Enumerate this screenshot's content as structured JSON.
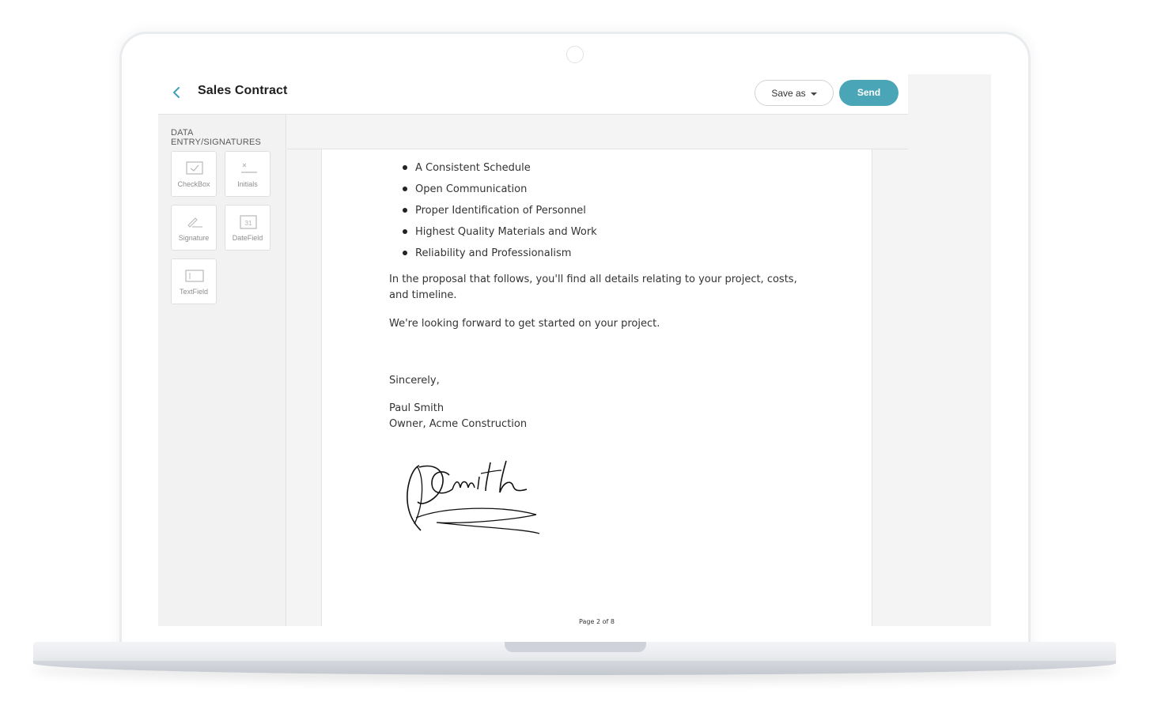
{
  "header": {
    "title": "Sales Contract",
    "save_as_label": "Save as",
    "send_label": "Send"
  },
  "sidebar": {
    "title": "DATA ENTRY/SIGNATURES",
    "tools": [
      {
        "label": "CheckBox",
        "icon": "checkbox-icon"
      },
      {
        "label": "Initials",
        "icon": "initials-icon"
      },
      {
        "label": "Signature",
        "icon": "pen-icon"
      },
      {
        "label": "DateField",
        "icon": "calendar-icon"
      },
      {
        "label": "TextField",
        "icon": "textfield-icon"
      }
    ],
    "date_icon_text": "31"
  },
  "document": {
    "bullets": [
      "A Consistent Schedule",
      "Open Communication",
      "Proper Identification of Personnel",
      "Highest Quality Materials and Work",
      "Reliability and Professionalism"
    ],
    "paragraph_1": "In the proposal that follows, you'll find all details relating to your project, costs, and timeline.",
    "paragraph_2": "We're looking forward to get started on your project.",
    "closing": "Sincerely,",
    "signer_name": "Paul Smith",
    "signer_title": "Owner, Acme Construction",
    "page_indicator": "Page 2 of 8"
  },
  "colors": {
    "accent": "#4aa5b7",
    "back_icon": "#3ea0b5"
  }
}
